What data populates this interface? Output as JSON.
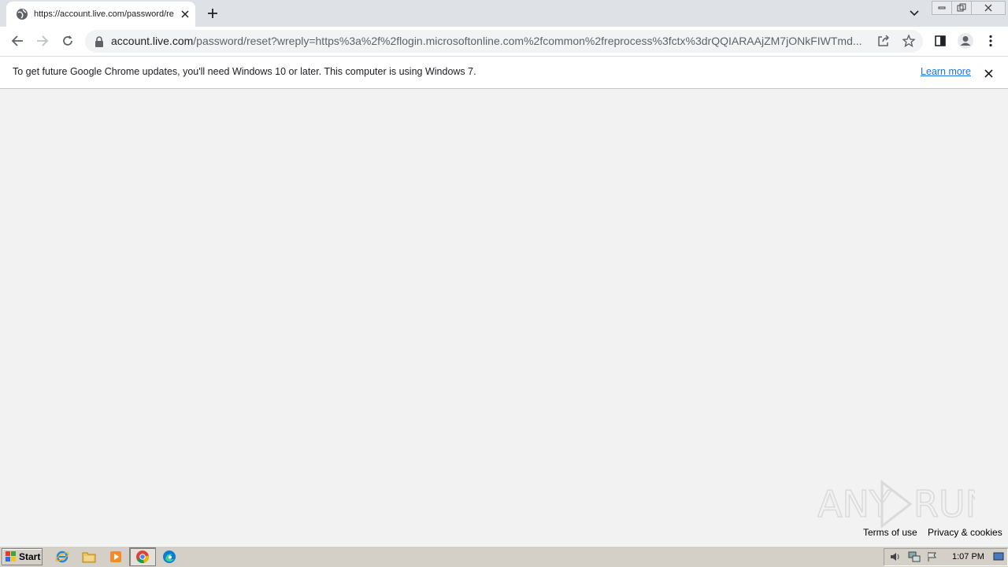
{
  "browser": {
    "tab": {
      "title": "https://account.live.com/password/reset"
    },
    "address_bar": {
      "host": "account.live.com",
      "path": "/password/reset?wreply=https%3a%2f%2flogin.microsoftonline.com%2fcommon%2freprocess%3fctx%3drQQIARAAjZM7jONkFIWTmd..."
    }
  },
  "infobar": {
    "message": "To get future Google Chrome updates, you'll need Windows 10 or later. This computer is using Windows 7.",
    "link": "Learn more"
  },
  "footer": {
    "terms": "Terms of use",
    "privacy": "Privacy & cookies"
  },
  "watermark": {
    "text": "ANY RUN"
  },
  "taskbar": {
    "start_label": "Start",
    "clock": "1:07 PM",
    "pinned": [
      "internet-explorer-icon",
      "folder-icon",
      "media-player-icon",
      "chrome-icon",
      "edge-icon"
    ]
  },
  "colors": {
    "accent": "#1a73e8",
    "page_bg": "#f2f2f2",
    "tabstrip_bg": "#dee1e6"
  }
}
